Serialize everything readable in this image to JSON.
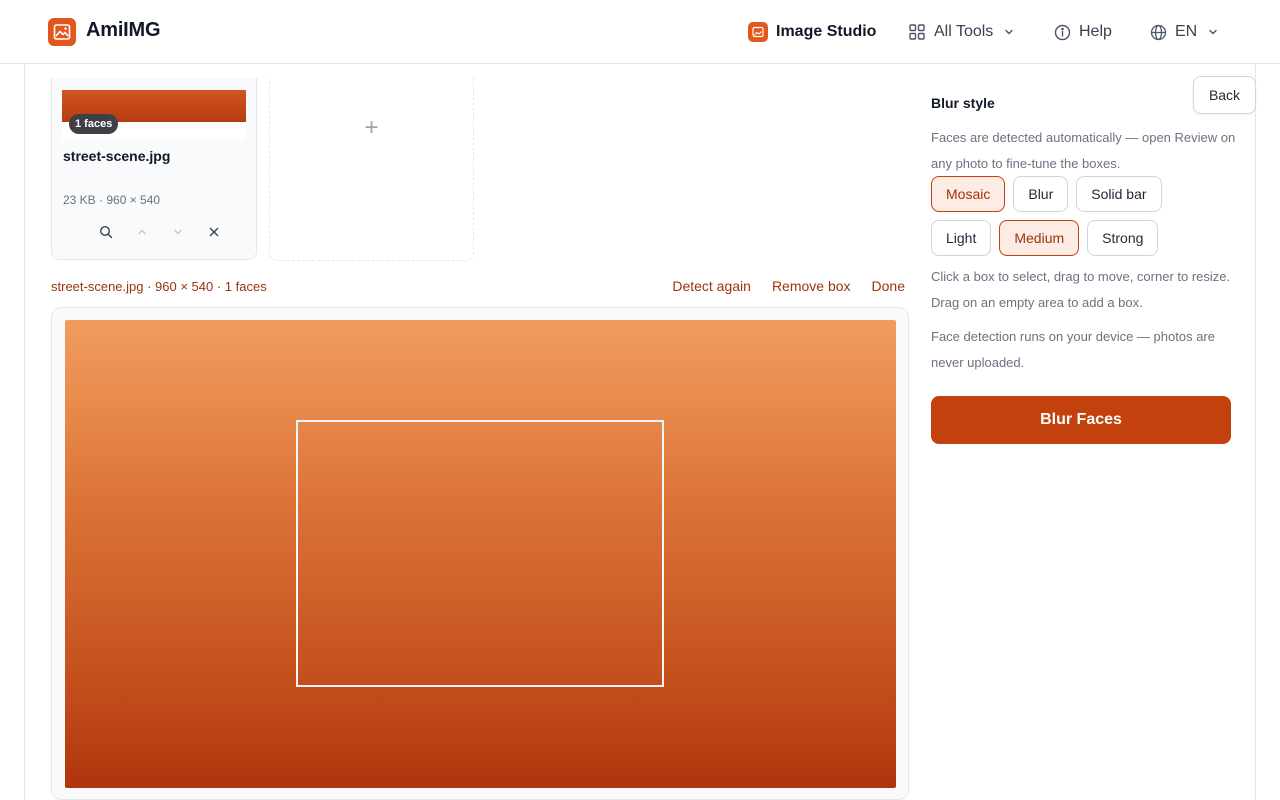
{
  "header": {
    "brand": "AmiIMG",
    "nav": {
      "studio": "Image Studio",
      "tools": "All Tools",
      "help": "Help",
      "lang": "EN"
    }
  },
  "file": {
    "name": "street-scene.jpg",
    "faces_badge": "1 faces",
    "meta": "23 KB · 960 × 540"
  },
  "add_tile": {
    "label": "+"
  },
  "editor": {
    "info": "street-scene.jpg · 960 × 540 · 1 faces",
    "actions": [
      "Detect again",
      "Remove box",
      "Done"
    ]
  },
  "panel": {
    "back": "Back",
    "title": "Blur style",
    "description": "Faces are detected automatically — open Review on any photo to fine-tune the boxes.",
    "styles": [
      {
        "label": "Mosaic",
        "active": true
      },
      {
        "label": "Blur",
        "active": false
      },
      {
        "label": "Solid bar",
        "active": false
      }
    ],
    "strengths": [
      {
        "label": "Light",
        "active": false
      },
      {
        "label": "Medium",
        "active": true
      },
      {
        "label": "Strong",
        "active": false
      }
    ],
    "hint_edit": "Click a box to select, drag to move, corner to resize. Drag on an empty area to add a box.",
    "hint_privacy": "Face detection runs on your device — photos are never uploaded.",
    "primary": "Blur Faces"
  },
  "colors": {
    "accent": "#c2410c",
    "brand": "#e2571e",
    "accent_soft": "#fdece3"
  }
}
